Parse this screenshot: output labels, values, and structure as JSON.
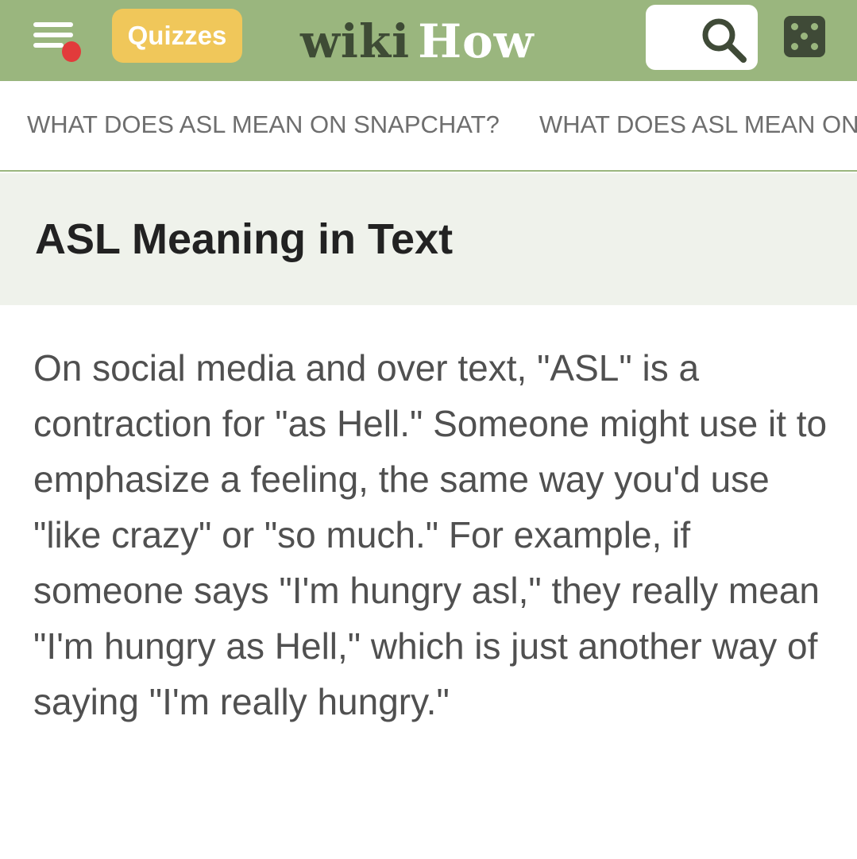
{
  "header": {
    "menu_icon": "hamburger-menu-icon",
    "notification_dot_color": "#e23b3b",
    "quizzes_label": "Quizzes",
    "logo_wiki": "wiki",
    "logo_how": "How",
    "search_icon": "search-icon",
    "random_icon": "dice-icon",
    "bar_color": "#9ab67e"
  },
  "subnav": {
    "items": [
      {
        "label": "WHAT DOES ASL MEAN ON SNAPCHAT?"
      },
      {
        "label": "WHAT DOES ASL MEAN ON"
      }
    ]
  },
  "section": {
    "title": "ASL Meaning in Text",
    "body": "On social media and over text, \"ASL\" is a contraction for \"as Hell.\" Someone might use it to emphasize a feeling, the same way you'd use \"like crazy\" or \"so much.\" For example, if someone says \"I'm hungry asl,\" they really mean \"I'm hungry as Hell,\" which is just another way of saying \"I'm really hungry.\""
  }
}
